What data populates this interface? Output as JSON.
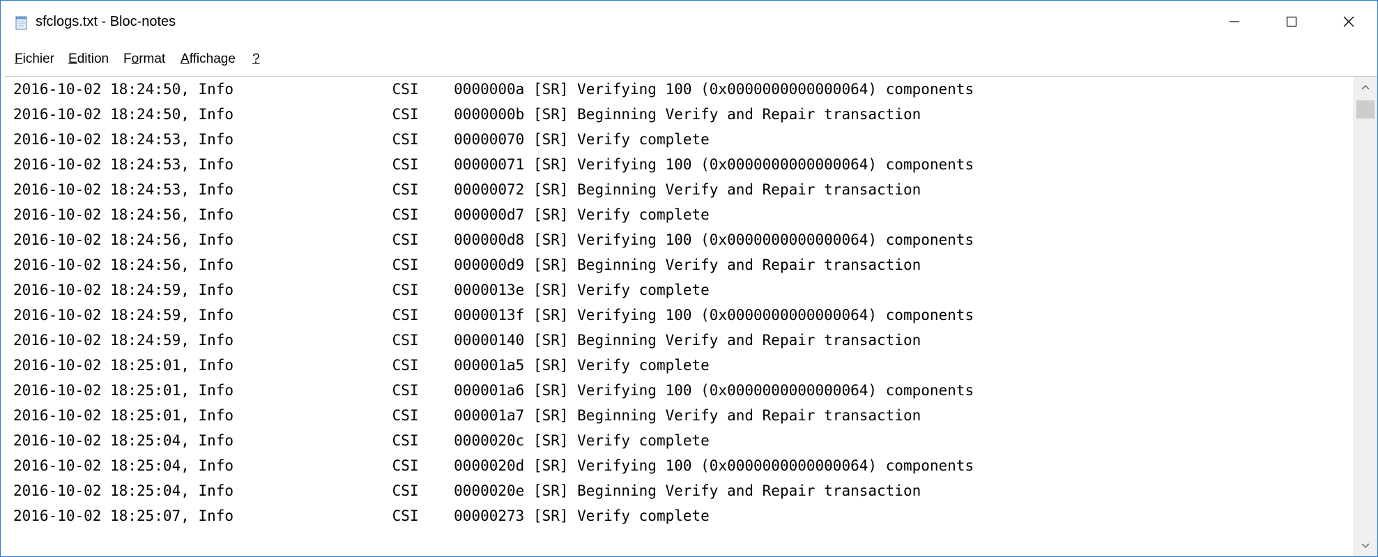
{
  "window": {
    "title": "sfclogs.txt - Bloc-notes",
    "controls": {
      "minimize_icon": "minimize-icon",
      "maximize_icon": "maximize-icon",
      "close_icon": "close-icon"
    }
  },
  "menu": {
    "fichier": {
      "accel": "F",
      "rest": "ichier"
    },
    "edition": {
      "accel": "E",
      "rest": "dition"
    },
    "format": {
      "pre": "F",
      "accel": "o",
      "rest": "rmat"
    },
    "affichage": {
      "accel": "A",
      "rest": "ffichage"
    },
    "help": {
      "accel": "?"
    }
  },
  "editor": {
    "lines": [
      "2016-10-02 18:24:50, Info                  CSI    0000000a [SR] Verifying 100 (0x0000000000000064) components",
      "2016-10-02 18:24:50, Info                  CSI    0000000b [SR] Beginning Verify and Repair transaction",
      "2016-10-02 18:24:53, Info                  CSI    00000070 [SR] Verify complete",
      "2016-10-02 18:24:53, Info                  CSI    00000071 [SR] Verifying 100 (0x0000000000000064) components",
      "2016-10-02 18:24:53, Info                  CSI    00000072 [SR] Beginning Verify and Repair transaction",
      "2016-10-02 18:24:56, Info                  CSI    000000d7 [SR] Verify complete",
      "2016-10-02 18:24:56, Info                  CSI    000000d8 [SR] Verifying 100 (0x0000000000000064) components",
      "2016-10-02 18:24:56, Info                  CSI    000000d9 [SR] Beginning Verify and Repair transaction",
      "2016-10-02 18:24:59, Info                  CSI    0000013e [SR] Verify complete",
      "2016-10-02 18:24:59, Info                  CSI    0000013f [SR] Verifying 100 (0x0000000000000064) components",
      "2016-10-02 18:24:59, Info                  CSI    00000140 [SR] Beginning Verify and Repair transaction",
      "2016-10-02 18:25:01, Info                  CSI    000001a5 [SR] Verify complete",
      "2016-10-02 18:25:01, Info                  CSI    000001a6 [SR] Verifying 100 (0x0000000000000064) components",
      "2016-10-02 18:25:01, Info                  CSI    000001a7 [SR] Beginning Verify and Repair transaction",
      "2016-10-02 18:25:04, Info                  CSI    0000020c [SR] Verify complete",
      "2016-10-02 18:25:04, Info                  CSI    0000020d [SR] Verifying 100 (0x0000000000000064) components",
      "2016-10-02 18:25:04, Info                  CSI    0000020e [SR] Beginning Verify and Repair transaction",
      "2016-10-02 18:25:07, Info                  CSI    00000273 [SR] Verify complete"
    ]
  },
  "scrollbar": {
    "up_icon": "chevron-up-icon",
    "down_icon": "chevron-down-icon"
  },
  "colors": {
    "window_border": "#2b78d4",
    "scrollbar_track": "#f0f0f0",
    "scrollbar_thumb": "#cdcdcd"
  }
}
